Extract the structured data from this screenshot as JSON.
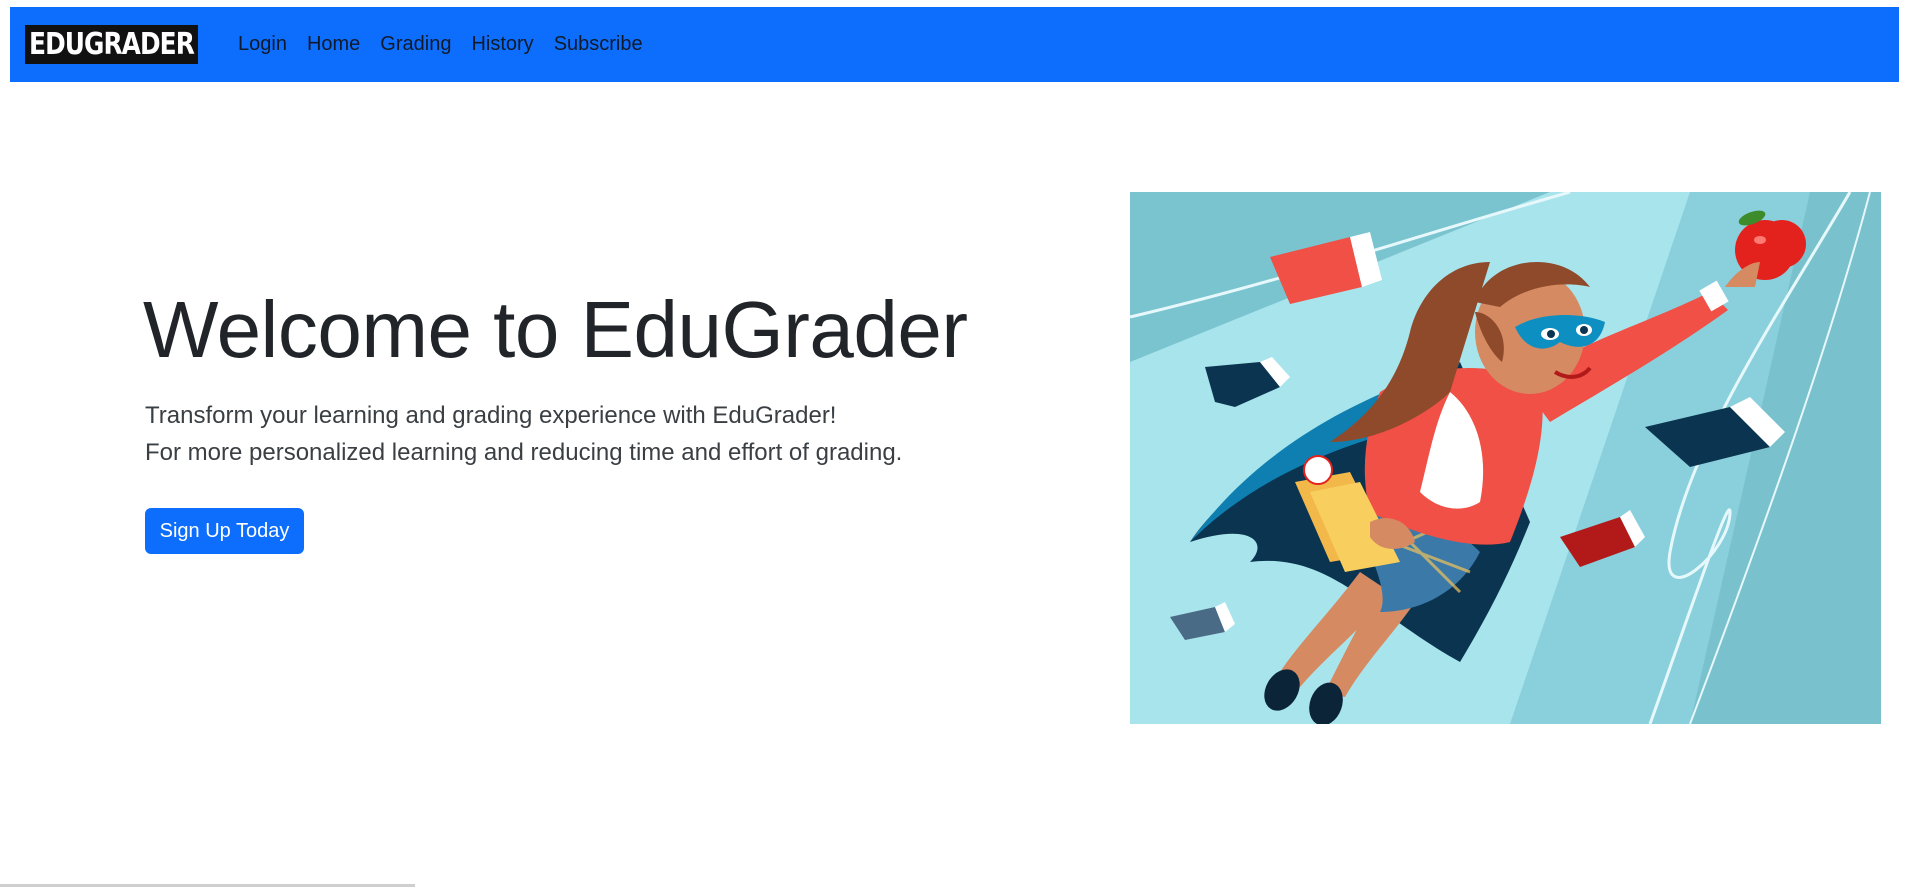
{
  "navbar": {
    "brand": "EDUGRADER",
    "links": [
      "Login",
      "Home",
      "Grading",
      "History",
      "Subscribe"
    ]
  },
  "hero": {
    "title": "Welcome to EduGrader",
    "lead_line1": "Transform your learning and grading experience with EduGrader!",
    "lead_line2": "For more personalized learning and reducing time and effort of grading.",
    "cta_label": "Sign Up Today"
  },
  "colors": {
    "primary": "#0d6efd",
    "brand_bg": "#111111",
    "illustration_bg": "#a8e4ec"
  },
  "illustration": {
    "subject": "superhero-teacher-illustration"
  }
}
